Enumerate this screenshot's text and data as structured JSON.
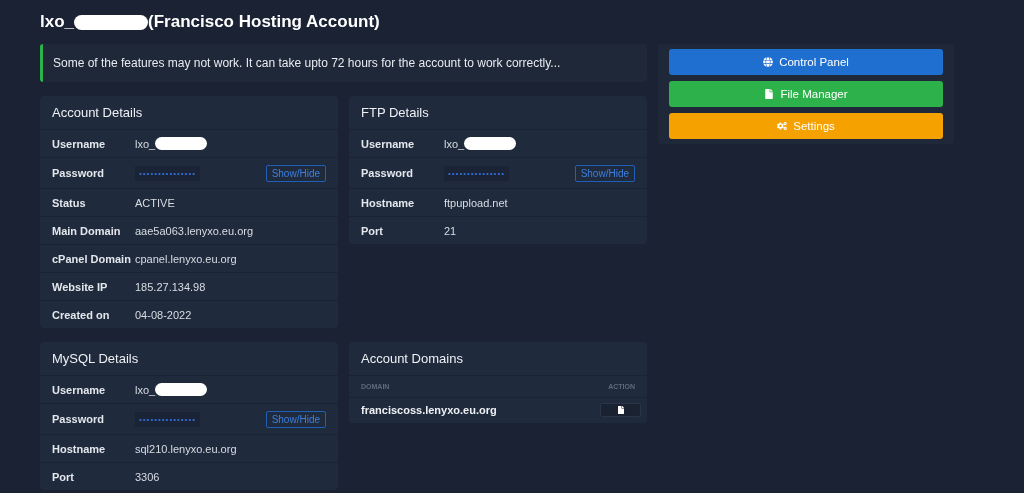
{
  "page_title": {
    "prefix": "lxo_",
    "redacted": true,
    "suffix": "(Francisco Hosting Account)"
  },
  "alert": {
    "text": "Some of the features may not work. It can take upto 72 hours for the account to work correctly..."
  },
  "cards": [
    {
      "title": "Account Details",
      "rows": [
        {
          "kind": "text",
          "label": "Username",
          "value": "lxo_",
          "redacted": true
        },
        {
          "kind": "password",
          "label": "Password",
          "value": "•••••••••••••••",
          "button": "Show/Hide"
        },
        {
          "kind": "text",
          "label": "Status",
          "value": "ACTIVE",
          "redacted": false
        },
        {
          "kind": "text",
          "label": "Main Domain",
          "value": "aae5a063.lenyxo.eu.org",
          "redacted": false
        },
        {
          "kind": "text",
          "label": "cPanel Domain",
          "value": "cpanel.lenyxo.eu.org",
          "redacted": false
        },
        {
          "kind": "text",
          "label": "Website IP",
          "value": "185.27.134.98",
          "redacted": false
        },
        {
          "kind": "text",
          "label": "Created on",
          "value": "04-08-2022",
          "redacted": false
        }
      ]
    },
    {
      "title": "FTP Details",
      "rows": [
        {
          "kind": "text",
          "label": "Username",
          "value": "lxo_",
          "redacted": true
        },
        {
          "kind": "password",
          "label": "Password",
          "value": "•••••••••••••••",
          "button": "Show/Hide"
        },
        {
          "kind": "text",
          "label": "Hostname",
          "value": "ftpupload.net",
          "redacted": false
        },
        {
          "kind": "text",
          "label": "Port",
          "value": "21",
          "redacted": false
        }
      ]
    },
    {
      "title": "MySQL Details",
      "rows": [
        {
          "kind": "text",
          "label": "Username",
          "value": "lxo_",
          "redacted": true
        },
        {
          "kind": "password",
          "label": "Password",
          "value": "•••••••••••••••",
          "button": "Show/Hide"
        },
        {
          "kind": "text",
          "label": "Hostname",
          "value": "sql210.lenyxo.eu.org",
          "redacted": false
        },
        {
          "kind": "text",
          "label": "Port",
          "value": "3306",
          "redacted": false
        }
      ]
    }
  ],
  "domains": {
    "title": "Account Domains",
    "columns": [
      "DOMAIN",
      "ACTION"
    ],
    "rows": [
      {
        "domain": "franciscoss.lenyxo.eu.org"
      }
    ]
  },
  "actions": [
    {
      "label": "Control Panel",
      "color": "#1f6fd0",
      "kind": "globe"
    },
    {
      "label": "File Manager",
      "color": "#2db14a",
      "kind": "file"
    },
    {
      "label": "Settings",
      "color": "#f5a100",
      "kind": "gears"
    }
  ]
}
